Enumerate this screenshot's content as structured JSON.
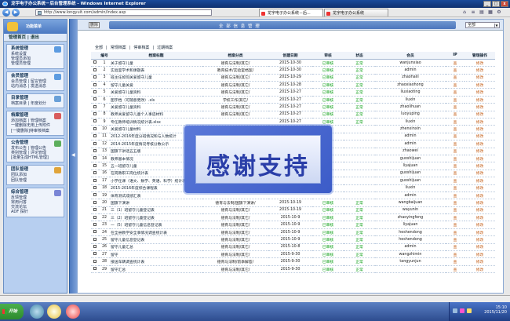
{
  "browser": {
    "window_title": "龙宇电子办公系统－后台管理系统 - Windows Internet Explorer",
    "address": "http://www.longyuit.com/admin/index.asp",
    "tabs": [
      {
        "label": "龙宇电子办公系统－后..."
      },
      {
        "label": "龙宇电子办公系统"
      }
    ]
  },
  "sidebar": {
    "panel_title": "功能菜单",
    "top_links": "管理首页 | 退出",
    "sections": [
      {
        "title": "系统管理",
        "items": [
          "系统设置",
          "管理员添加",
          "管理员管理"
        ],
        "icon": "gear-icon"
      },
      {
        "title": "会员管理",
        "items": [
          "会员管理 | 留言管理",
          "站内消息 | 发送消息"
        ],
        "icon": "members-icon"
      },
      {
        "title": "目录管理",
        "items": [
          "档案目录 | 年度划分"
        ],
        "icon": "folder-icon"
      },
      {
        "title": "档案管理",
        "items": [
          "添加档案 | 管理档案",
          "一键删除无用上传附件",
          "[一键删除]待审核档案"
        ],
        "icon": "archive-icon"
      },
      {
        "title": "公告管理",
        "items": [
          "发布公告 | 管理公告",
          "类别管理 | 评论管理",
          "[批量生成HTML管理]"
        ],
        "icon": "notice-icon"
      },
      {
        "title": "团队管理",
        "items": [
          "团队添加",
          "团队管理"
        ],
        "icon": "team-icon"
      },
      {
        "title": "综合管理",
        "items": [
          "反馈管理",
          "常用问答",
          "交流论坛",
          "ADF 探针"
        ],
        "icon": "misc-icon"
      }
    ]
  },
  "main": {
    "delete_label": "删除",
    "title": "全 部 信 息 管 理",
    "filter_value": "全部",
    "categories": [
      "全部",
      "常规档案",
      "停审档案",
      "过期档案"
    ],
    "columns": [
      "",
      "编号",
      "档案标题",
      "档案分类",
      "创建日期",
      "审核",
      "状态",
      "会员",
      "IP",
      "管理操作"
    ],
    "rows": [
      [
        "1",
        "关于留守儿童",
        "德育与法制/其它/",
        "2015-10-30",
        "已审核",
        "正常",
        "wanjunxiao",
        "查",
        "修改"
      ],
      [
        "2",
        "实验室学术和课题表",
        "教育技术/实验室档案/",
        "2015-10-30",
        "已审核",
        "正常",
        "admin",
        "查",
        "修改"
      ],
      [
        "3",
        "班主任如何关爱留守儿童",
        "德育与法制/其它/",
        "2015-10-29",
        "已审核",
        "正常",
        "zhaohaili",
        "查",
        "修改"
      ],
      [
        "4",
        "留守儿童关爱",
        "德育与法制/其它/",
        "2015-10-28",
        "已审核",
        "正常",
        "zhaoxiaohong",
        "查",
        "修改"
      ],
      [
        "5",
        "关爱留守儿童资料",
        "德育与法制/其它/",
        "2015-10-27",
        "已审核",
        "正常",
        "liuxiaoting",
        "查",
        "修改"
      ],
      [
        "6",
        "图字档（可随意更改）.xls",
        "学校工作/其它/",
        "2015-10-27",
        "已审核",
        "正常",
        "liuxin",
        "查",
        "修改"
      ],
      [
        "7",
        "关爱留守儿童资料",
        "德育与法制/其它/",
        "2015-10-27",
        "已审核",
        "正常",
        "zhaolihuan",
        "查",
        "修改"
      ],
      [
        "8",
        "教师关爱留守儿童个人事迹材料",
        "德育与法制/其它/",
        "2015-10-27",
        "已审核",
        "正常",
        "luoyuping",
        "查",
        "修改"
      ],
      [
        "9",
        "专任教师培训情况统计表.xlsx",
        "",
        "2015-10-27",
        "已审核",
        "正常",
        "liuxin",
        "查",
        "修改"
      ],
      [
        "10",
        "关爱留守儿童材料",
        "",
        "",
        "",
        "",
        "zhenxinxin",
        "查",
        "修改"
      ],
      [
        "11",
        "2012-2016年度分班情况和与人数统计",
        "",
        "",
        "",
        "",
        "admin",
        "查",
        "修改"
      ],
      [
        "12",
        "2014-2015年度情况考核分数公示",
        "",
        "",
        "",
        "",
        "admin",
        "查",
        "修改"
      ],
      [
        "13",
        "国旗下讲话五五版",
        "",
        "",
        "",
        "",
        "zhaowei",
        "查",
        "修改"
      ],
      [
        "14",
        "教师基本情况",
        "",
        "",
        "",
        "",
        "guoshijuan",
        "查",
        "修改"
      ],
      [
        "15",
        "五一班留守儿童",
        "",
        "",
        "",
        "",
        "liyajuan",
        "查",
        "修改"
      ],
      [
        "16",
        "在岗教职工岗位统计表",
        "",
        "",
        "",
        "",
        "guoshijuan",
        "查",
        "修改"
      ],
      [
        "17",
        "小学任课（语文、数学、英语、科学）统计表",
        "",
        "",
        "",
        "",
        "guoshijuan",
        "查",
        "修改"
      ],
      [
        "18",
        "2015-2016年度综合课程表",
        "",
        "",
        "",
        "",
        "liuxin",
        "查",
        "修改"
      ],
      [
        "19",
        "体育测试成绩汇表",
        "",
        "",
        "",
        "",
        "admin",
        "查",
        "修改"
      ],
      [
        "20",
        "国旗下演讲",
        "德育与法制/国旗下演讲/",
        "2015-10-19",
        "已审核",
        "正常",
        "wangbaijuan",
        "查",
        "修改"
      ],
      [
        "21",
        "三（1）班留守儿童登记表",
        "德育与法制/其它/",
        "2015-10-19",
        "已审核",
        "正常",
        "wayunin",
        "查",
        "修改"
      ],
      [
        "22",
        "三（2）班留守儿童登记表",
        "德育与法制/其它/",
        "2015-10-9",
        "已审核",
        "正常",
        "zhaoyingfeng",
        "查",
        "修改"
      ],
      [
        "23",
        "一（5）班留守儿童信息登记表",
        "德育与法制/其它/",
        "2015-10-9",
        "已审核",
        "正常",
        "liyajuan",
        "查",
        "修改"
      ],
      [
        "24",
        "在全县教学安全事情况调查统计表",
        "德育与法制/其它/",
        "2015-10-9",
        "已审核",
        "正常",
        "heshendong",
        "查",
        "修改"
      ],
      [
        "25",
        "留守儿童信息登记表",
        "德育与法制/其它/",
        "2015-10-9",
        "已审核",
        "正常",
        "heshendong",
        "查",
        "修改"
      ],
      [
        "26",
        "留守儿童汇总",
        "德育与法制/其它/",
        "2015-10-8",
        "已审核",
        "正常",
        "admin",
        "查",
        "修改"
      ],
      [
        "27",
        "留守",
        "德育与法制/其它/",
        "2015-9-30",
        "已审核",
        "正常",
        "wangzhimin",
        "查",
        "修改"
      ],
      [
        "28",
        "接送车辆调查统计表",
        "德育与法制/前季解答/",
        "2015-9-30",
        "已审核",
        "正常",
        "tangyunjun",
        "查",
        "修改"
      ],
      [
        "29",
        "留守汇总",
        "德育与法制/其它/",
        "2015-9-30",
        "已审核",
        "正常",
        "",
        "查",
        "修改"
      ]
    ]
  },
  "overlay": {
    "text": "感谢支持"
  },
  "taskbar": {
    "start_label": "开始",
    "time": "15:10",
    "date": "2015/11/20"
  },
  "colors": {
    "approved_status": "#11a11a",
    "action_link": "#c25a12",
    "sidebar_bg": "#b7cff0",
    "overlay_text": "#2a3ea8"
  }
}
